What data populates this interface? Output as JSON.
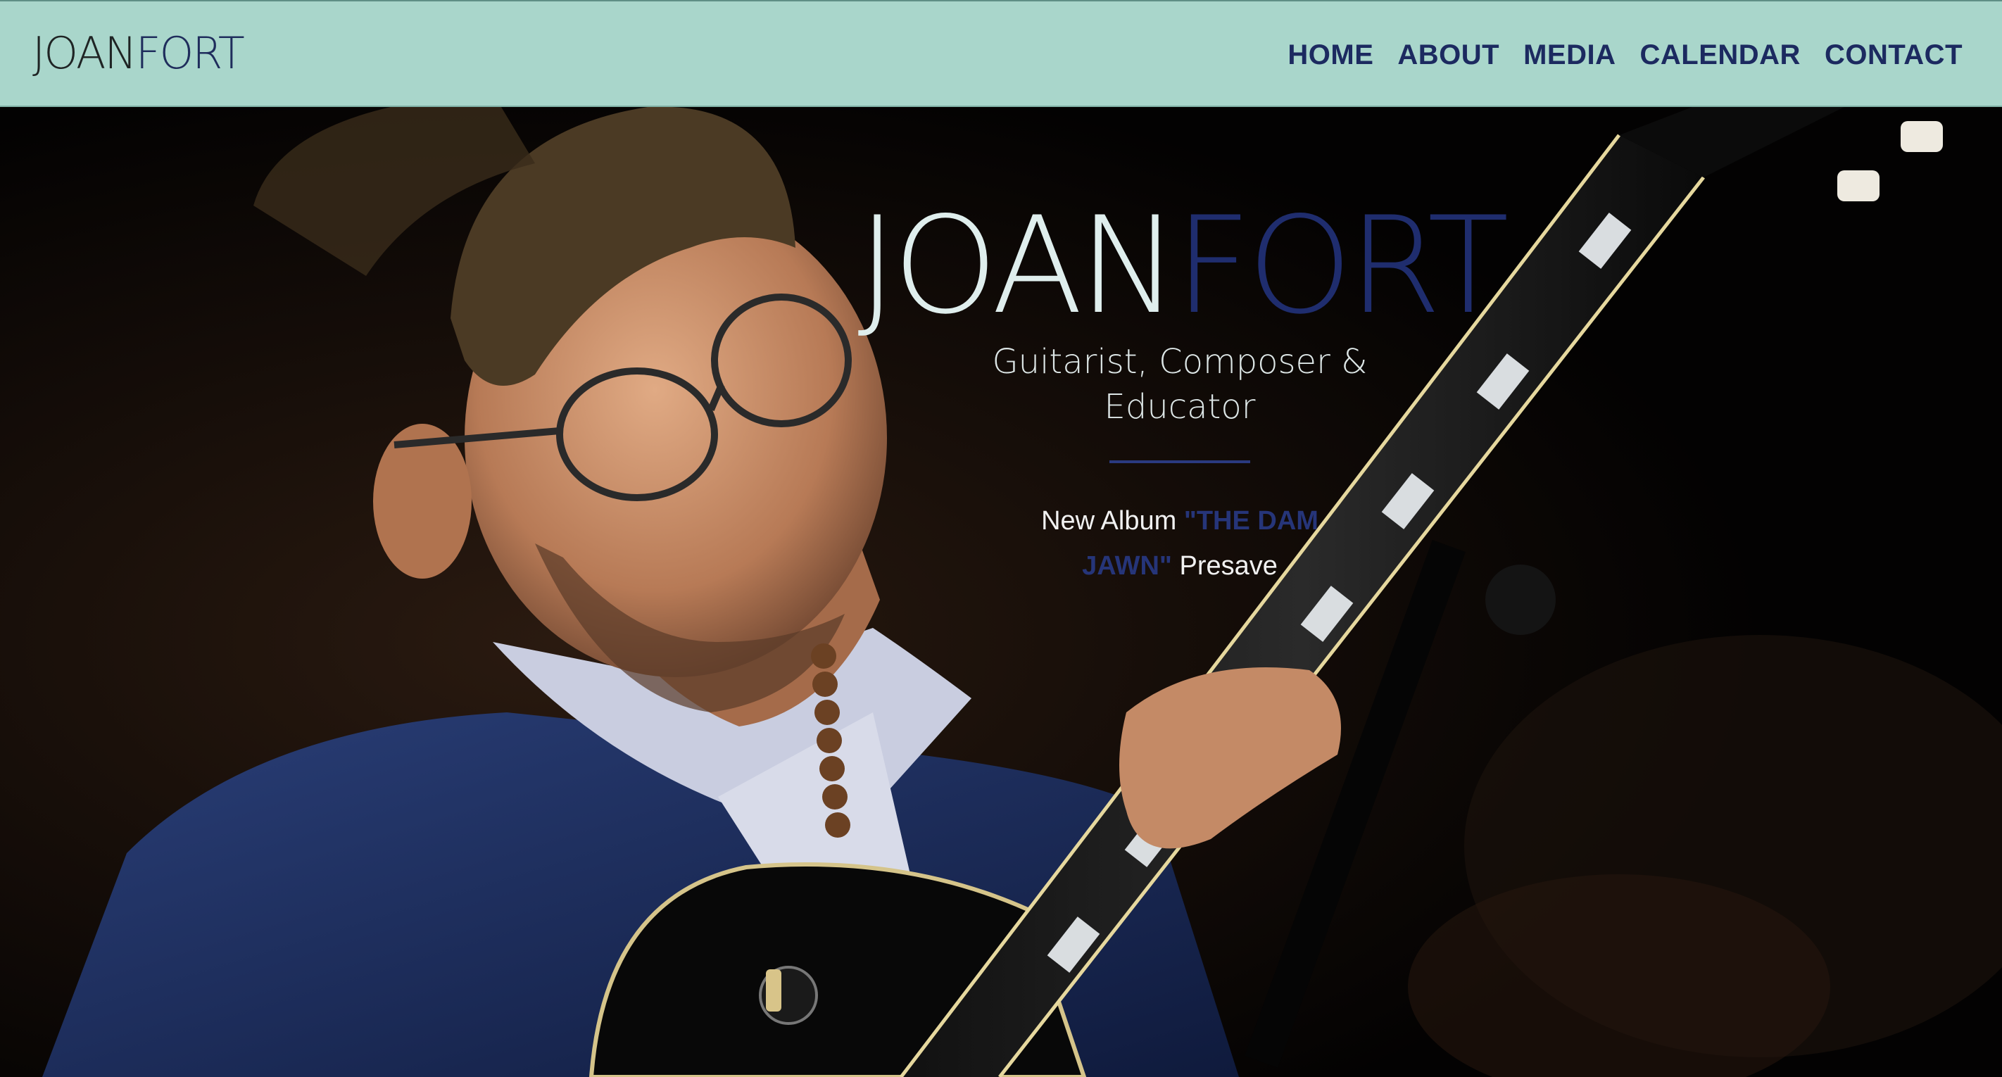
{
  "header": {
    "logo_part1": "JOAN",
    "logo_part2": "FORT",
    "nav": [
      {
        "label": "HOME"
      },
      {
        "label": "ABOUT"
      },
      {
        "label": "MEDIA"
      },
      {
        "label": "CALENDAR"
      },
      {
        "label": "CONTACT"
      }
    ]
  },
  "hero": {
    "title_part1": "JOAN",
    "title_part2": "FORT",
    "subtitle": "Guitarist, Composer & Educator",
    "album_prefix": "New Album ",
    "album_title": "\"THE DAM JAWN\"",
    "album_suffix": " Presave"
  },
  "colors": {
    "header_bg": "#a9d6cb",
    "nav_text": "#1c2a60",
    "accent_blue": "#1f2d6e",
    "hero_bg": "#050403"
  }
}
